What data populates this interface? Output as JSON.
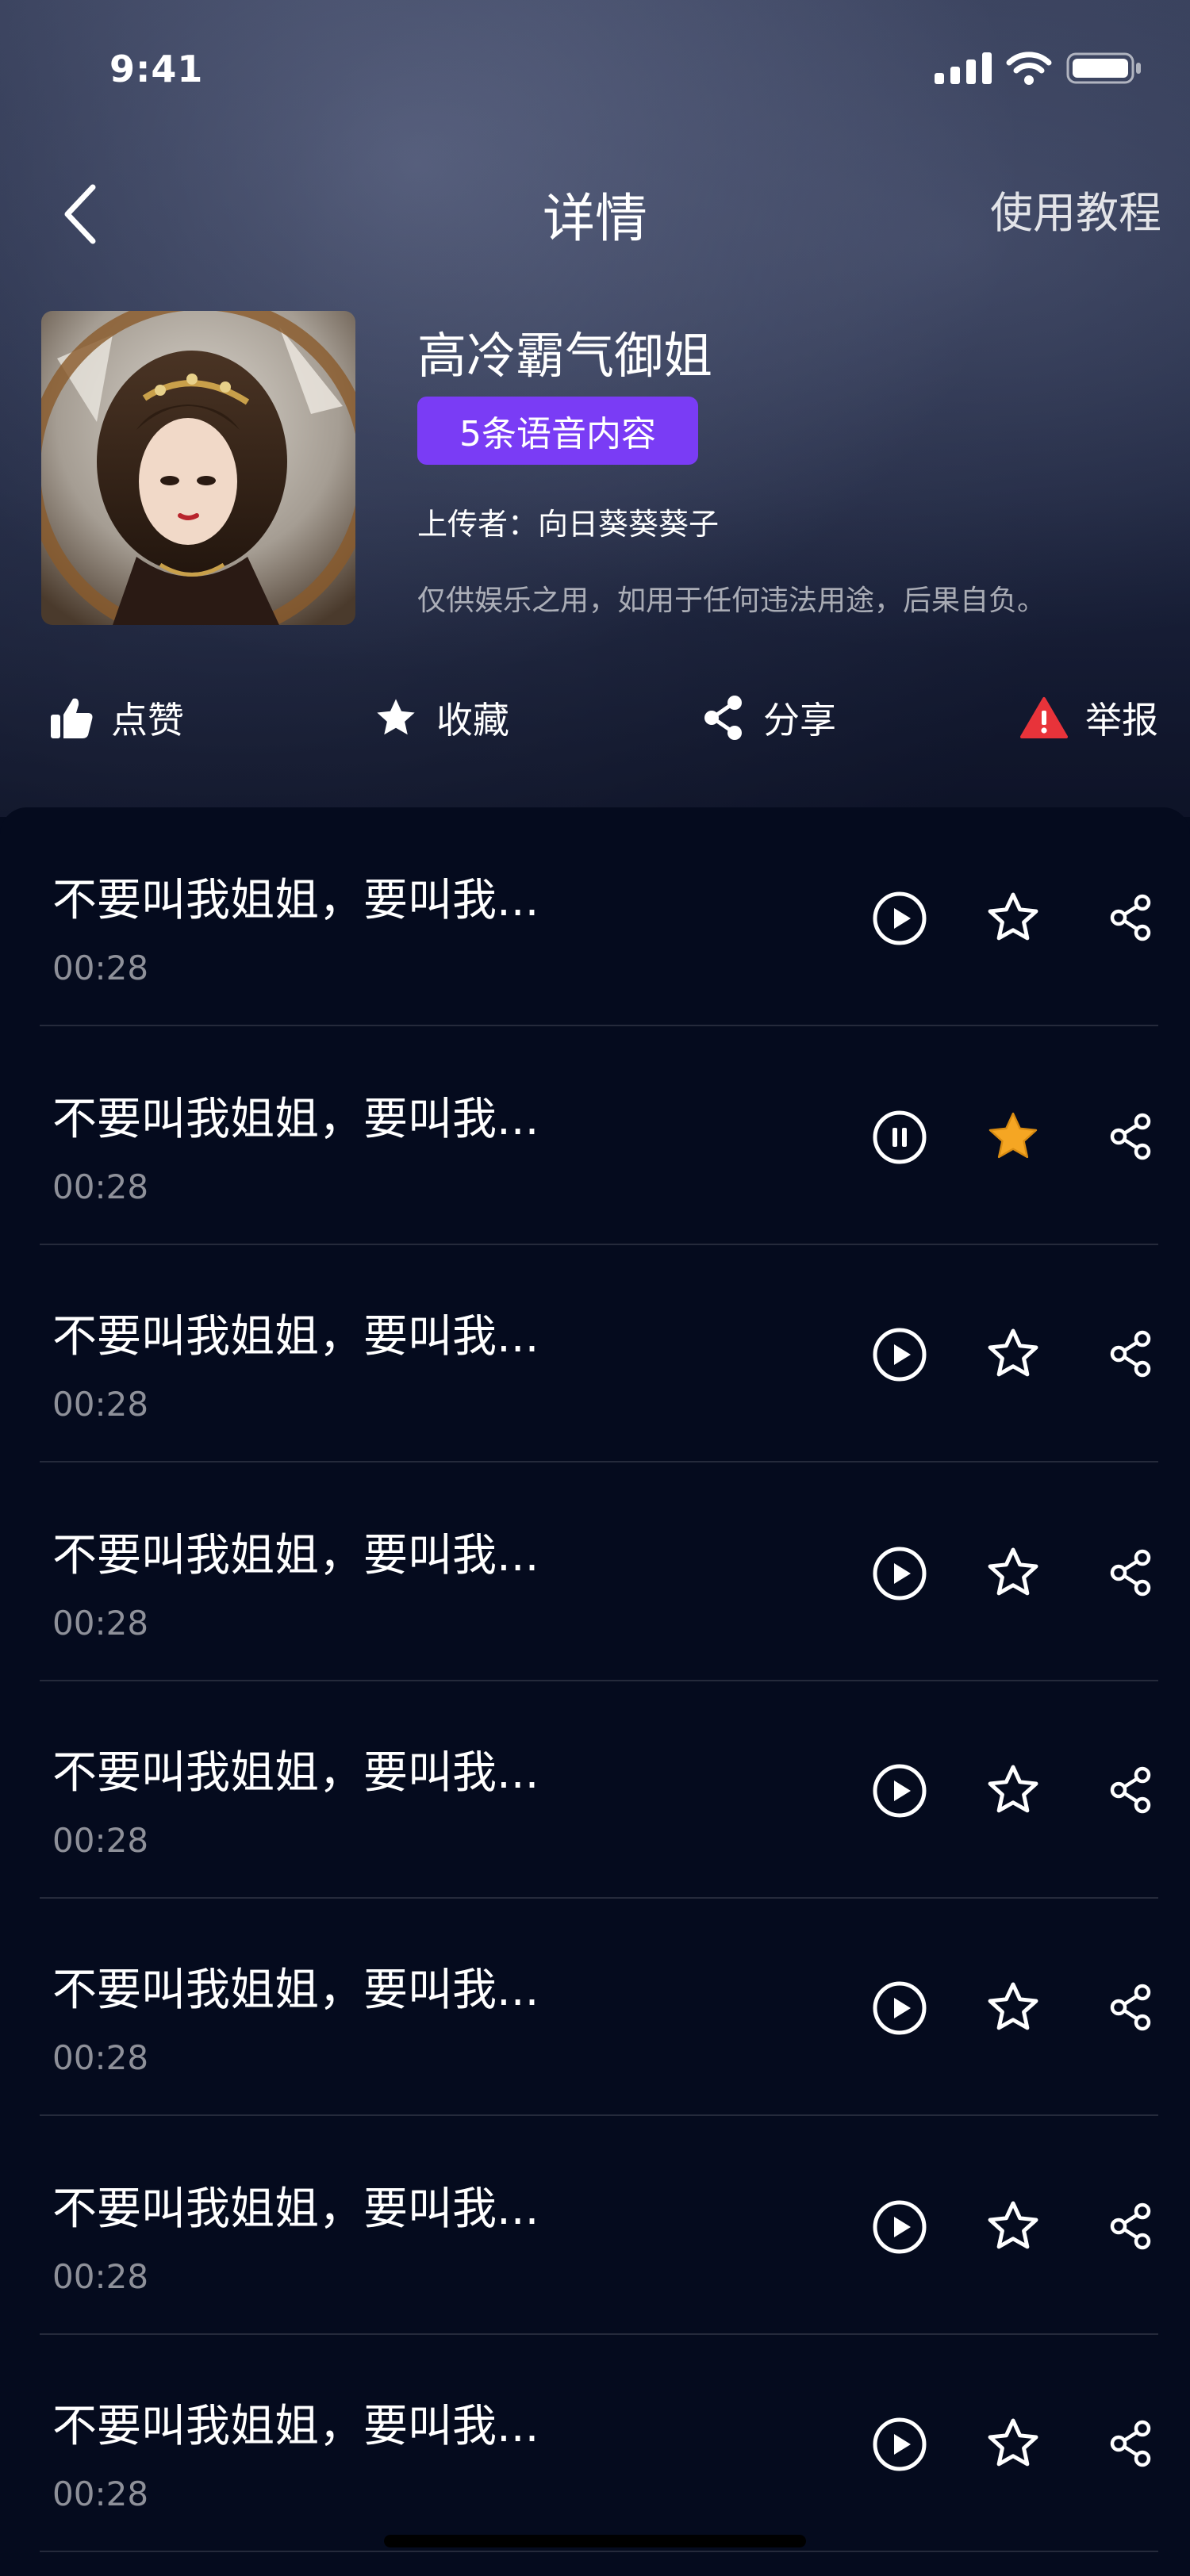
{
  "status_bar": {
    "time": "9:41"
  },
  "nav": {
    "title": "详情",
    "tutorial_label": "使用教程"
  },
  "pack": {
    "title": "高冷霸气御姐",
    "badge": "5条语音内容",
    "uploader": "上传者：向日葵葵葵子",
    "disclaimer": "仅供娱乐之用，如用于任何违法用途，后果自负。"
  },
  "actions": {
    "like": "点赞",
    "favorite": "收藏",
    "share": "分享",
    "report": "举报"
  },
  "colors": {
    "accent": "#7a3cf5",
    "background": "#050b1e",
    "star_active": "#f5a623",
    "report_red": "#e8333a"
  },
  "voice_list": [
    {
      "title": "不要叫我姐姐，要叫我...",
      "duration": "00:28",
      "state": "play",
      "favorited": false
    },
    {
      "title": "不要叫我姐姐，要叫我...",
      "duration": "00:28",
      "state": "pause",
      "favorited": true
    },
    {
      "title": "不要叫我姐姐，要叫我...",
      "duration": "00:28",
      "state": "play",
      "favorited": false
    },
    {
      "title": "不要叫我姐姐，要叫我...",
      "duration": "00:28",
      "state": "play",
      "favorited": false
    },
    {
      "title": "不要叫我姐姐，要叫我...",
      "duration": "00:28",
      "state": "play",
      "favorited": false
    },
    {
      "title": "不要叫我姐姐，要叫我...",
      "duration": "00:28",
      "state": "play",
      "favorited": false
    },
    {
      "title": "不要叫我姐姐，要叫我...",
      "duration": "00:28",
      "state": "play",
      "favorited": false
    },
    {
      "title": "不要叫我姐姐，要叫我...",
      "duration": "00:28",
      "state": "play",
      "favorited": false
    }
  ]
}
